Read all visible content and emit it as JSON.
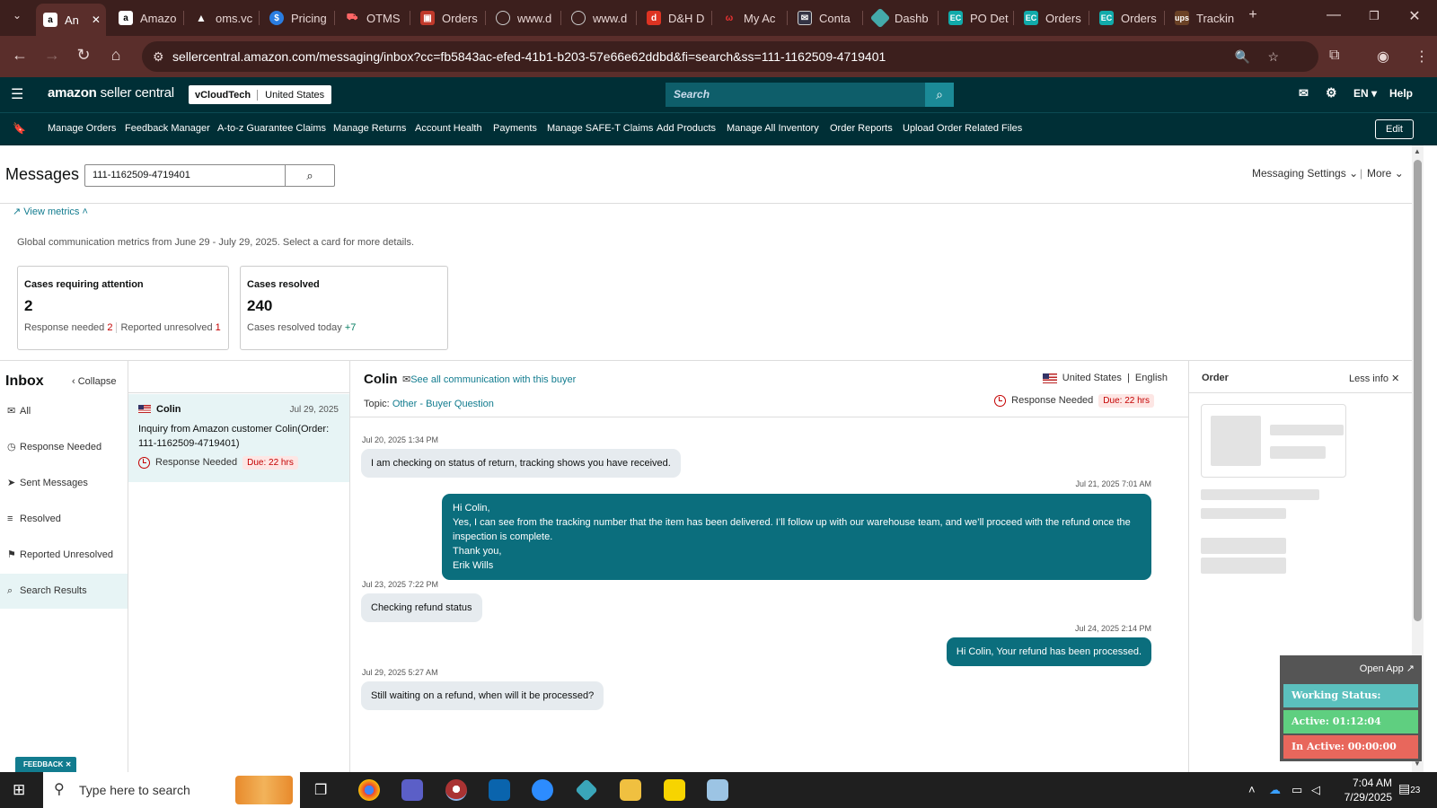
{
  "browser": {
    "tabs": [
      {
        "label": "An",
        "active": true
      },
      {
        "label": "Amazo"
      },
      {
        "label": "oms.vc"
      },
      {
        "label": "Pricing"
      },
      {
        "label": "OTMS"
      },
      {
        "label": "Orders"
      },
      {
        "label": "www.d"
      },
      {
        "label": "www.d"
      },
      {
        "label": "D&H D"
      },
      {
        "label": "My Ac"
      },
      {
        "label": "Conta"
      },
      {
        "label": "Dashb"
      },
      {
        "label": "PO Det"
      },
      {
        "label": "Orders"
      },
      {
        "label": "Orders"
      },
      {
        "label": "Trackin"
      }
    ],
    "url": "sellercentral.amazon.com/messaging/inbox?cc=fb5843ac-efed-41b1-b203-57e66e62ddbd&fi=search&ss=111-1162509-4719401"
  },
  "header": {
    "logo_bold": "amazon",
    "logo_rest": " seller central",
    "account": "vCloudTech",
    "marketplace": "United States",
    "search_placeholder": "Search",
    "language": "EN",
    "help": "Help"
  },
  "shortcuts": [
    "Manage Orders",
    "Feedback Manager",
    "A-to-z Guarantee Claims",
    "Manage Returns",
    "Account Health",
    "Payments",
    "Manage SAFE-T Claims",
    "Add Products",
    "Manage All Inventory",
    "Order Reports",
    "Upload Order Related Files"
  ],
  "shortcuts_edit": "Edit",
  "messages": {
    "title": "Messages",
    "search_value": "111-1162509-4719401",
    "settings": "Messaging Settings",
    "more": "More",
    "view_metrics": "View metrics",
    "metrics_desc": "Global communication metrics from June 29 - July 29, 2025. Select a card for more details."
  },
  "cards": {
    "attention": {
      "title": "Cases requiring attention",
      "count": "2",
      "resp_label": "Response needed",
      "resp_val": "2",
      "unres_label": "Reported unresolved",
      "unres_val": "1"
    },
    "resolved": {
      "title": "Cases resolved",
      "count": "240",
      "today_label": "Cases resolved today",
      "today_val": "+7"
    }
  },
  "inbox": {
    "title": "Inbox",
    "collapse": "Collapse",
    "items": [
      "All",
      "Response Needed",
      "Sent Messages",
      "Resolved",
      "Reported Unresolved",
      "Search Results"
    ]
  },
  "thread": {
    "name": "Colin",
    "date": "Jul 29, 2025",
    "subject": "Inquiry from Amazon customer Colin(Order: 111-1162509-4719401)",
    "status": "Response Needed",
    "due": "Due: 22 hrs"
  },
  "conversation": {
    "buyer": "Colin",
    "see_all": "See all communication with this buyer",
    "topic_label": "Topic:",
    "topic": "Other - Buyer Question",
    "country": "United States",
    "language": "English",
    "status": "Response Needed",
    "due": "Due: 22 hrs",
    "messages": [
      {
        "ts": "Jul 20, 2025 1:34 PM",
        "dir": "in",
        "text": "I am checking on status of return, tracking shows you have received."
      },
      {
        "ts": "Jul 21, 2025 7:01 AM",
        "dir": "out",
        "lines": [
          "Hi Colin,",
          "Yes, I can see from the tracking number that the item has been delivered. I’ll follow up with our warehouse team, and we’ll proceed with the refund once the inspection is complete.",
          "Thank you,",
          "Erik Wills"
        ]
      },
      {
        "ts": "Jul 23, 2025 7:22 PM",
        "dir": "in",
        "text": "Checking refund status"
      },
      {
        "ts": "Jul 24, 2025 2:14 PM",
        "dir": "out",
        "text": "Hi Colin, Your refund has been processed."
      },
      {
        "ts": "Jul 29, 2025 5:27 AM",
        "dir": "in",
        "text": "Still waiting on a refund, when will it be processed?"
      }
    ]
  },
  "order_panel": {
    "title": "Order",
    "less_info": "Less info"
  },
  "feedback": "FEEDBACK",
  "widget": {
    "open_app": "Open App",
    "status": "Working Status: Active",
    "active": "Active: 01:12:04",
    "inactive": "In Active: 00:00:00",
    "colors": {
      "status": "#5bc0be",
      "active": "#5fcf80",
      "inactive": "#e8675c"
    }
  },
  "taskbar": {
    "search_placeholder": "Type here to search",
    "time": "7:04 AM",
    "date": "7/29/2025",
    "notifications": "23"
  }
}
